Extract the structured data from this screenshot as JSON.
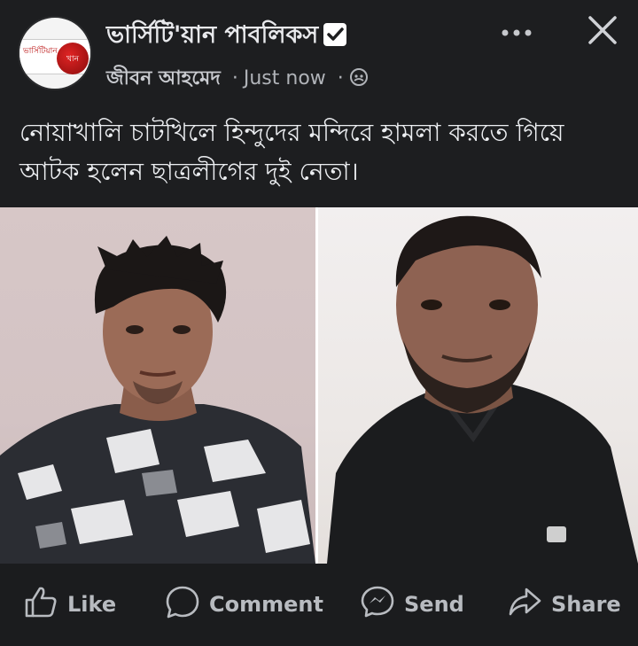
{
  "header": {
    "page_name": "ভার্সিটি'য়ান পাবলিকস",
    "author": "জীবন আহমেদ",
    "timestamp": "Just now",
    "separator": "·",
    "avatar_logo_text": "ভার্সিটিয়ান",
    "avatar_seal_text": "খান",
    "more_icon": "more-horizontal-icon",
    "close_icon": "close-icon",
    "verified_icon": "verified-check-icon",
    "audience_icon": "custom-audience-icon"
  },
  "post": {
    "text": "নোয়াখালি চাটখিলে হিন্দুদের মন্দিরে হামলা করতে গিয়ে আটক হলেন ছাত্রলীগের দুই নেতা।"
  },
  "actions": {
    "like": "Like",
    "comment": "Comment",
    "send": "Send",
    "share": "Share"
  },
  "colors": {
    "background": "#1d1e20",
    "text_primary": "#e8e9ec",
    "text_secondary": "#b0b3b8",
    "accent_verified": "#ffffff"
  }
}
